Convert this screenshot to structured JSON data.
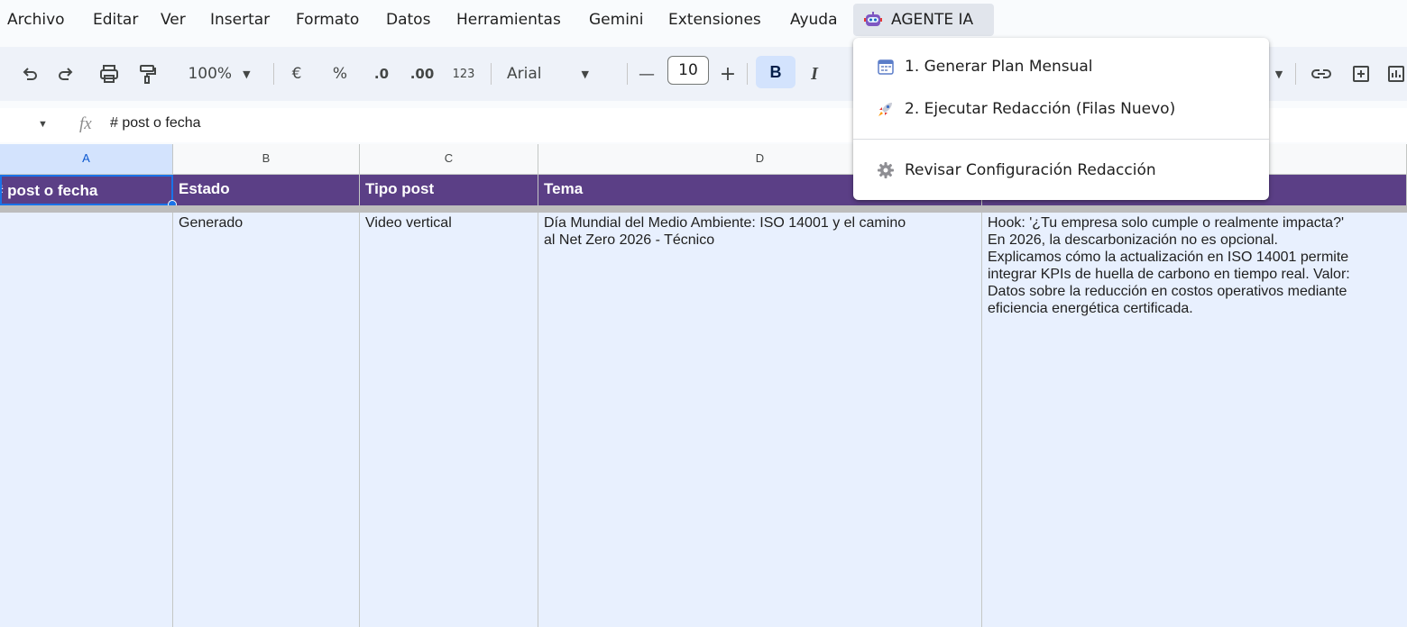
{
  "menubar": {
    "items": [
      "Archivo",
      "Editar",
      "Ver",
      "Insertar",
      "Formato",
      "Datos",
      "Herramientas",
      "Gemini",
      "Extensiones",
      "Ayuda"
    ],
    "agent_menu_label": "AGENTE IA"
  },
  "toolbar": {
    "zoom": "100%",
    "currency": "€",
    "percent": "%",
    "decrease_decimal": ".0",
    "increase_decimal": ".00",
    "number_format": "123",
    "font_name": "Arial",
    "font_size": "10",
    "minus": "—",
    "plus": "+",
    "bold": "B",
    "italic": "I"
  },
  "formula_bar": {
    "fx_label": "fx",
    "content": "# post o fecha"
  },
  "column_headers": [
    "A",
    "B",
    "C",
    "D"
  ],
  "header_row": {
    "a": "# post o fecha",
    "b": "Estado",
    "c": "Tipo post",
    "d": "Tema"
  },
  "row": {
    "a": "",
    "b": "Generado",
    "c": "Video vertical",
    "d_lines": [
      "Día Mundial del Medio Ambiente: ISO 14001 y el camino",
      "al Net Zero 2026 - Técnico"
    ],
    "e_lines": [
      "Hook: '¿Tu empresa solo cumple o realmente impacta?'",
      "En 2026, la descarbonización no es opcional.",
      "Explicamos cómo la actualización en ISO 14001 permite",
      "integrar KPIs de huella de carbono en tiempo real. Valor:",
      "Datos sobre la reducción en costos operativos mediante",
      "eficiencia energética certificada."
    ]
  },
  "dropdown": {
    "items": [
      {
        "label": "1. Generar Plan Mensual",
        "icon": "calendar-icon"
      },
      {
        "label": "2. Ejecutar Redacción (Filas Nuevo)",
        "icon": "rocket-icon"
      },
      {
        "label": "Revisar Configuración Redacción",
        "icon": "gear-icon"
      }
    ]
  },
  "colors": {
    "header_purple": "#5b3f86",
    "cell_selected": "#e8f0fe",
    "bold_active": "#d3e3fd"
  }
}
